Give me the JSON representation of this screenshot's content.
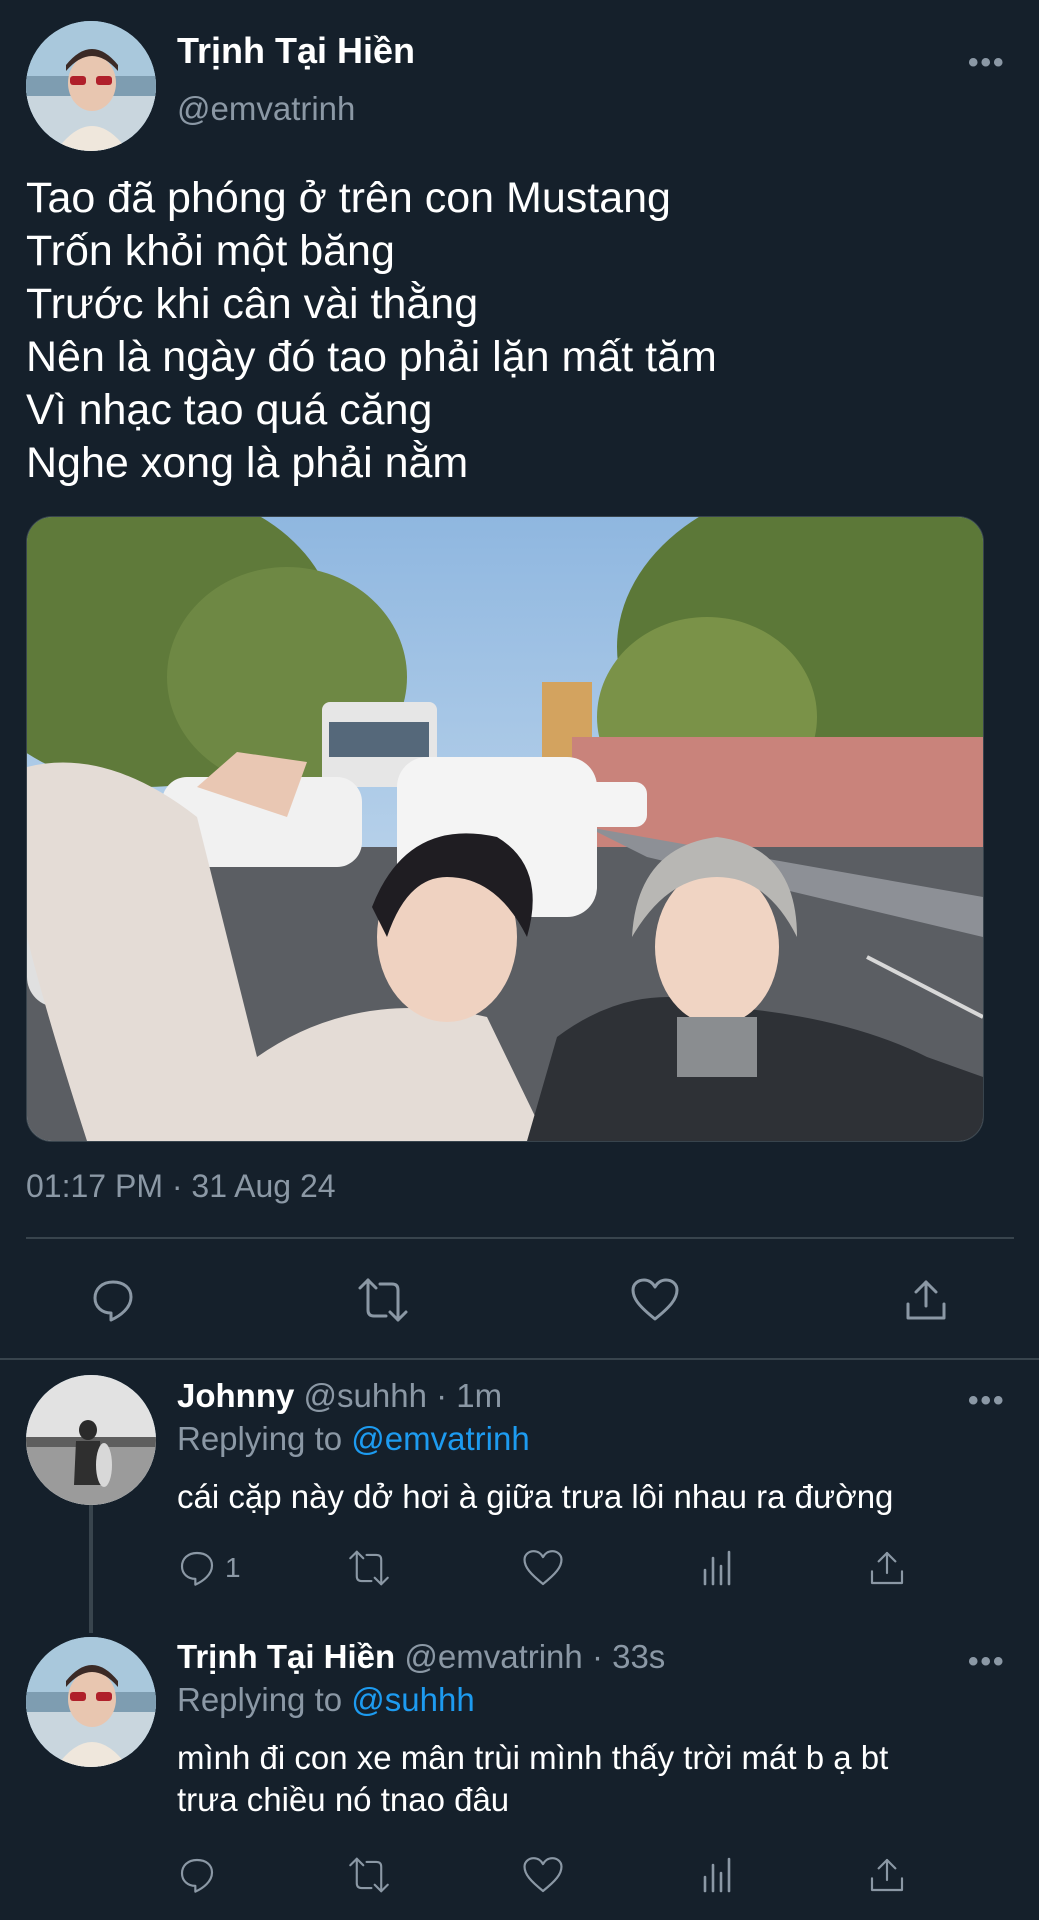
{
  "tweet": {
    "author_name": "Trịnh Tại Hiền",
    "author_handle": "@emvatrinh",
    "text_lines": [
      "Tao đã phóng ở trên con Mustang",
      "Trốn khỏi một băng",
      "Trước khi cân vài thằng",
      "Nên là ngày đó tao phải lặn mất tăm",
      "Vì nhạc tao quá căng",
      "Nghe xong là phải nằm"
    ],
    "timestamp": "01:17 PM · 31 Aug 24",
    "more_icon": "more-dots-icon",
    "actions": [
      "reply-icon",
      "retweet-icon",
      "like-icon",
      "share-icon"
    ]
  },
  "replies": [
    {
      "name": "Johnny",
      "handle": "@suhhh",
      "time": "· 1m",
      "replying_prefix": "Replying to",
      "replying_to": "@emvatrinh",
      "text": "cái cặp này dở hơi à giữa trưa lôi nhau ra đường",
      "reply_count": "1"
    },
    {
      "name": "Trịnh Tại Hiền",
      "handle": "@emvatrinh",
      "time": "· 33s",
      "replying_prefix": "Replying to",
      "replying_to": "@suhhh",
      "text_lines": [
        "mình đi con xe mân trùi mình thấy trời mát b ạ bt",
        "trưa chiều nó tnao đâu"
      ]
    }
  ],
  "colors": {
    "background": "#15202b",
    "text_primary": "#ffffff",
    "text_secondary": "#8b98a5",
    "accent": "#1d9bf0",
    "divider": "#38444d"
  }
}
